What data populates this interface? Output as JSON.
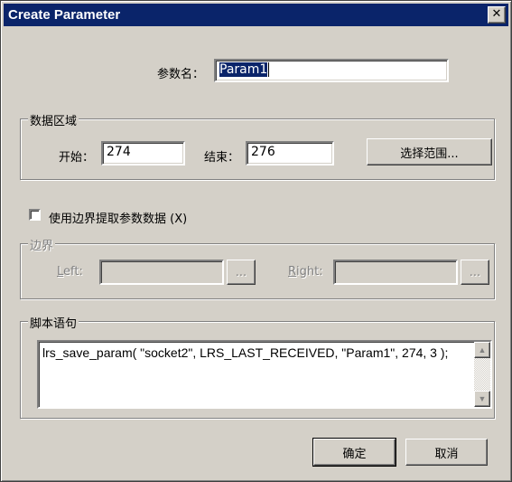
{
  "window": {
    "title": "Create Parameter",
    "close_glyph": "✕"
  },
  "param_name": {
    "label": "参数名：",
    "value": "Param1"
  },
  "data_region": {
    "title": "数据区域",
    "start_label": "开始：",
    "start_value": "274",
    "end_label": "结束：",
    "end_value": "276",
    "select_range_button": "选择范围..."
  },
  "boundary_checkbox": {
    "label": "使用边界提取参数数据 (X)",
    "checked": false
  },
  "boundary": {
    "title": "边界",
    "left_label": "Left:",
    "left_value": "",
    "left_browse": "...",
    "right_label": "Right:",
    "right_value": "",
    "right_browse": "..."
  },
  "script": {
    "title": "脚本语句",
    "text": "lrs_save_param( \"socket2\", LRS_LAST_RECEIVED, \"Param1\", 274, 3 );"
  },
  "buttons": {
    "ok": "确定",
    "cancel": "取消"
  },
  "icons": {
    "close": "close-icon",
    "scroll_up": "scroll-up-arrow-icon",
    "scroll_down": "scroll-down-arrow-icon"
  },
  "colors": {
    "titlebar": "#0a246a",
    "face": "#d4d0c8",
    "selection": "#0a246a"
  }
}
